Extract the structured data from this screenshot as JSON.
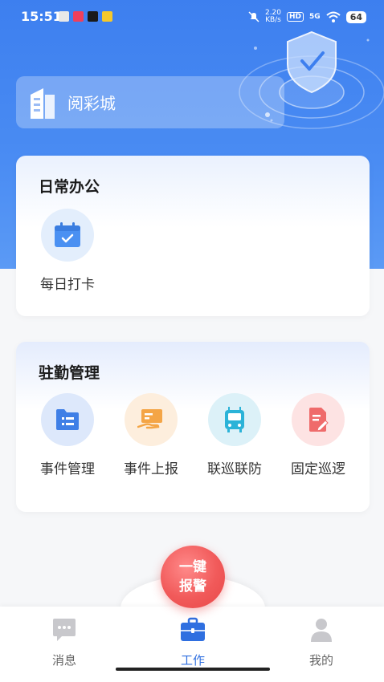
{
  "status_bar": {
    "time": "15:51",
    "net_speed_value": "2.20",
    "net_speed_unit": "KB/s",
    "network": "5G",
    "hd": "HD",
    "battery": "64"
  },
  "company": {
    "name": "阅彩城"
  },
  "daily_office": {
    "title": "日常办公",
    "items": [
      {
        "label": "每日打卡",
        "icon": "calendar-check-icon",
        "color": "#4a90f2"
      }
    ]
  },
  "station_management": {
    "title": "驻勤管理",
    "items": [
      {
        "label": "事件管理",
        "icon": "folder-list-icon",
        "color": "#3f7fe6"
      },
      {
        "label": "事件上报",
        "icon": "hand-card-icon",
        "color": "#f4a546"
      },
      {
        "label": "联巡联防",
        "icon": "bus-icon",
        "color": "#2bb3d8"
      },
      {
        "label": "固定巡逻",
        "icon": "document-edit-icon",
        "color": "#ef6b6b"
      }
    ]
  },
  "sos_button": {
    "line1": "一键",
    "line2": "报警"
  },
  "tabbar": {
    "tabs": [
      {
        "label": "消息",
        "icon": "chat-icon",
        "active": false
      },
      {
        "label": "工作",
        "icon": "briefcase-icon",
        "active": true
      },
      {
        "label": "我的",
        "icon": "user-icon",
        "active": false
      }
    ]
  },
  "colors": {
    "primary": "#3d7fef",
    "alert": "#f15a5a"
  }
}
